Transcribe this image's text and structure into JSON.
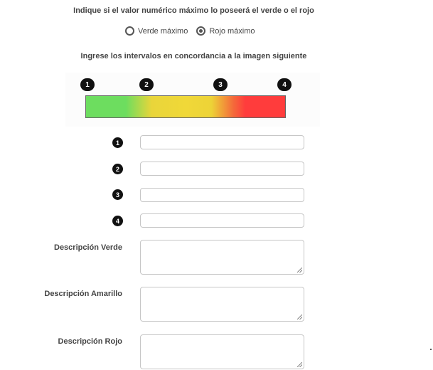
{
  "question": "Indique si el valor numérico máximo lo poseerá el verde o el rojo",
  "options": [
    {
      "label": "Verde máximo",
      "selected": false
    },
    {
      "label": "Rojo máximo",
      "selected": true
    }
  ],
  "instructions": "Ingrese los intervalos en concordancia a la imagen siguiente",
  "scale": {
    "colors": [
      "#6ddd5f",
      "#f0d838",
      "#ff3c3c"
    ],
    "markers": [
      "1",
      "2",
      "3",
      "4"
    ]
  },
  "intervals": [
    {
      "badge": "1",
      "value": ""
    },
    {
      "badge": "2",
      "value": ""
    },
    {
      "badge": "3",
      "value": ""
    },
    {
      "badge": "4",
      "value": ""
    }
  ],
  "descriptions": [
    {
      "label": "Descripción Verde",
      "value": ""
    },
    {
      "label": "Descripción Amarillo",
      "value": ""
    },
    {
      "label": "Descripción Rojo",
      "value": ""
    }
  ]
}
